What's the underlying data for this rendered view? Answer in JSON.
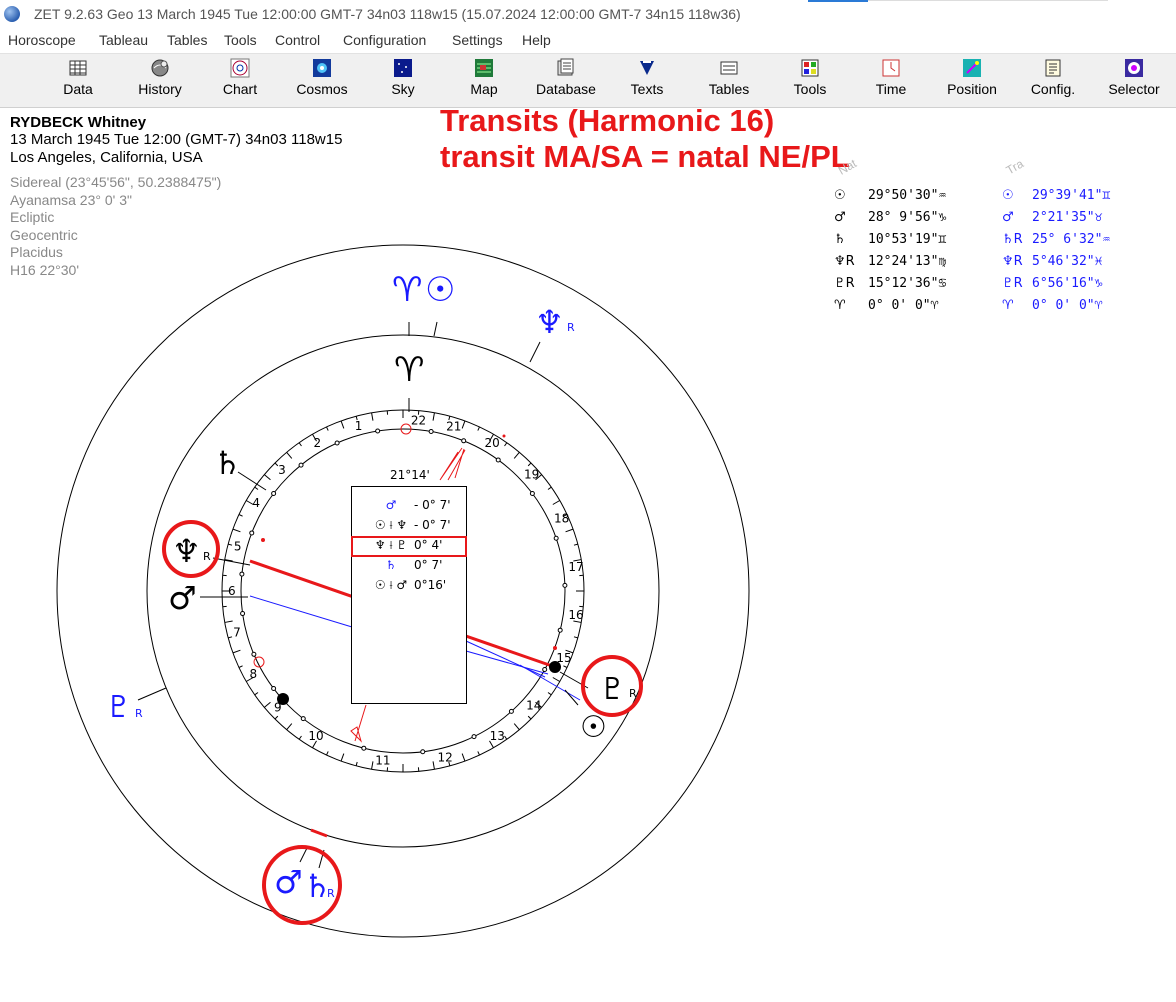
{
  "window": {
    "title": "ZET 9.2.63 Geo   13 March 1945  Tue  12:00:00 GMT-7 34n03  118w15  (15.07.2024  12:00:00 GMT-7 34n15  118w36)"
  },
  "menu": [
    "Horoscope",
    "Tableau",
    "Tables",
    "Tools",
    "Control",
    "Configuration",
    "Settings",
    "Help"
  ],
  "toolbar": [
    {
      "label": "Data",
      "icon": "data-grid-icon"
    },
    {
      "label": "History",
      "icon": "history-globe-icon"
    },
    {
      "label": "Chart",
      "icon": "chart-wheel-icon"
    },
    {
      "label": "Cosmos",
      "icon": "cosmos-icon"
    },
    {
      "label": "Sky",
      "icon": "sky-icon"
    },
    {
      "label": "Map",
      "icon": "map-icon"
    },
    {
      "label": "Database",
      "icon": "database-icon"
    },
    {
      "label": "Texts",
      "icon": "texts-icon"
    },
    {
      "label": "Tables",
      "icon": "tables-icon"
    },
    {
      "label": "Tools",
      "icon": "tools-icon"
    },
    {
      "label": "Time",
      "icon": "time-icon"
    },
    {
      "label": "Position",
      "icon": "position-icon"
    },
    {
      "label": "Config.",
      "icon": "config-icon"
    },
    {
      "label": "Selector",
      "icon": "selector-icon"
    }
  ],
  "person": {
    "name": "RYDBECK Whitney",
    "date": "13 March 1945  Tue  12:00 (GMT-7) 34n03  118w15",
    "place": "Los Angeles, California, USA"
  },
  "settings": [
    "Sidereal (23°45'56\", 50.2388475\")",
    "Ayanamsa 23° 0' 3\"",
    "Ecliptic",
    "Geocentric",
    "Placidus",
    "H16  22°30'"
  ],
  "headline": {
    "line1": "Transits (Harmonic 16)",
    "line2": "transit MA/SA = natal NE/PL"
  },
  "columns": {
    "natal": "Nat",
    "transit": "Tra"
  },
  "positions": [
    {
      "nsym": "☉",
      "nval": "29°50'30\"♒",
      "tsym": "☉",
      "tval": "29°39'41\"♊"
    },
    {
      "nsym": "♂",
      "nval": "28° 9'56\"♑",
      "tsym": "♂",
      "tval": " 2°21'35\"♉"
    },
    {
      "nsym": "♄",
      "nval": "10°53'19\"♊",
      "tsym": "♄R",
      "tval": "25° 6'32\"♒"
    },
    {
      "nsym": "♆R",
      "nval": "12°24'13\"♍",
      "tsym": "♆R",
      "tval": " 5°46'32\"♓"
    },
    {
      "nsym": "♇R",
      "nval": "15°12'36\"♋",
      "tsym": "♇R",
      "tval": " 6°56'16\"♑"
    },
    {
      "nsym": "♈",
      "nval": " 0° 0' 0\"♈",
      "tsym": "♈",
      "tval": " 0° 0' 0\"♈"
    }
  ],
  "wheel": {
    "house_numbers": [
      "1",
      "2",
      "3",
      "4",
      "5",
      "6",
      "7",
      "8",
      "9",
      "10",
      "11",
      "12",
      "13",
      "14",
      "15",
      "16",
      "17",
      "18",
      "19",
      "20",
      "21",
      "22"
    ],
    "midpoint_label": "21°14'",
    "natal_glyphs": {
      "aries": "♈",
      "saturn": "♄",
      "neptune": "♆",
      "neptune_r": "R",
      "mars": "♂",
      "pluto": "♇",
      "pluto_r": "R",
      "sun": "☉"
    },
    "transit_glyphs": {
      "aries": "♈",
      "sun": "☉",
      "neptune": "♆",
      "neptune_r": "R",
      "pluto": "♇",
      "pluto_r": "R",
      "mars": "♂",
      "saturn": "♄",
      "saturn_r": "R"
    }
  },
  "aspects": [
    {
      "sym": "♂",
      "val": "- 0° 7'",
      "color": "#1a1aff"
    },
    {
      "sym": "☉ ⟊ ♆",
      "val": "- 0° 7'",
      "color": "#000000"
    },
    {
      "sym": "♆ ⟊ ♇",
      "val": "0° 4'",
      "color": "#000000"
    },
    {
      "sym": "♄",
      "val": "0° 7'",
      "color": "#1a1aff"
    },
    {
      "sym": "☉ ⟊ ♂",
      "val": "0°16'",
      "color": "#000000"
    }
  ],
  "colors": {
    "annotation": "#e8181a",
    "transit": "#1a1aff",
    "natal": "#000000"
  }
}
